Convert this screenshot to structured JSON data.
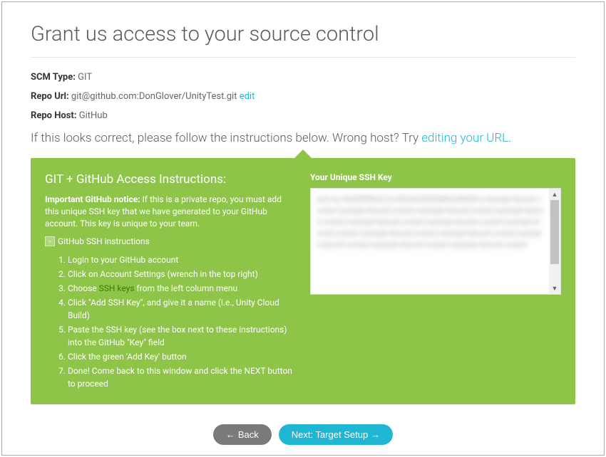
{
  "header": {
    "title": "Grant us access to your source control"
  },
  "scm": {
    "type_label": "SCM Type:",
    "type_value": "GIT",
    "repo_url_label": "Repo Url:",
    "repo_url_value": "git@github.com:DonGlover/UnityTest.git",
    "edit_link": "edit",
    "repo_host_label": "Repo Host:",
    "repo_host_value": "GitHub"
  },
  "instruction": {
    "prefix": "If this looks correct, please follow the instructions below. Wrong host? Try ",
    "link": "editing your URL",
    "suffix": "."
  },
  "panel": {
    "title": "GIT + GitHub Access Instructions:",
    "notice_strong": "Important GitHub notice:",
    "notice_text": " If this is a private repo, you must add this unique SSH key that we have generated to your GitHub account. This key is unique to your team.",
    "img_alt": "GitHub SSH instructions",
    "steps": [
      {
        "pre": "Login to your GitHub account",
        "link": "",
        "post": ""
      },
      {
        "pre": "Click on Account Settings (wrench in the top right)",
        "link": "",
        "post": ""
      },
      {
        "pre": "Choose ",
        "link": "SSH keys",
        "post": " from the left column menu"
      },
      {
        "pre": "Click \"Add SSH Key\", and give it a name (i.e., Unity Cloud Build)",
        "link": "",
        "post": ""
      },
      {
        "pre": "Paste the SSH key (see the box next to these instructions) into the GitHub \"Key\" field",
        "link": "",
        "post": ""
      },
      {
        "pre": "Click the green 'Add Key' button",
        "link": "",
        "post": ""
      },
      {
        "pre": "Done! Come back to this window and click the NEXT button to proceed",
        "link": "",
        "post": ""
      }
    ],
    "key_label": "Your Unique SSH Key"
  },
  "buttons": {
    "back": "Back",
    "next": "Next: Target Setup"
  },
  "glyphs": {
    "left_arrow": "←",
    "right_arrow": "→",
    "up_triangle": "▲",
    "down_triangle": "▼"
  }
}
